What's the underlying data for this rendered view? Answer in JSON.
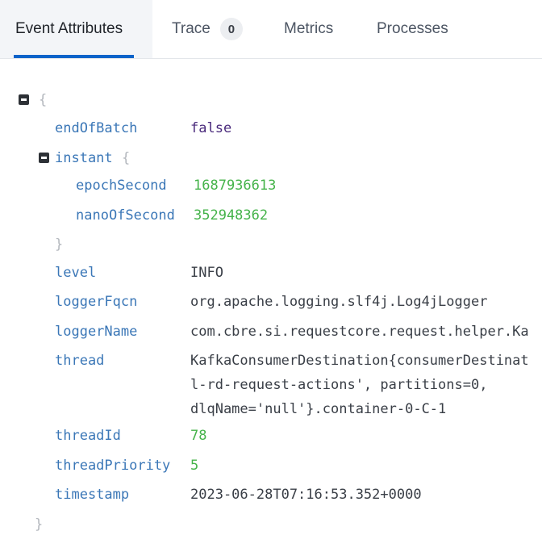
{
  "tabs": [
    {
      "label": "Event Attributes",
      "active": true
    },
    {
      "label": "Trace",
      "badge": "0"
    },
    {
      "label": "Metrics"
    },
    {
      "label": "Processes"
    }
  ],
  "tree": {
    "open_brace": "{",
    "close_brace": "}",
    "fields": {
      "endOfBatch": {
        "key": "endOfBatch",
        "value": "false"
      },
      "instant": {
        "key": "instant",
        "open": "{",
        "close": "}",
        "epochSecond": {
          "key": "epochSecond",
          "value": "1687936613"
        },
        "nanoOfSecond": {
          "key": "nanoOfSecond",
          "value": "352948362"
        }
      },
      "level": {
        "key": "level",
        "value": "INFO"
      },
      "loggerFqcn": {
        "key": "loggerFqcn",
        "value": "org.apache.logging.slf4j.Log4jLogger"
      },
      "loggerName": {
        "key": "loggerName",
        "value": "com.cbre.si.requestcore.request.helper.Ka"
      },
      "thread": {
        "key": "thread",
        "lines": [
          "KafkaConsumerDestination{consumerDestinat",
          "l-rd-request-actions', partitions=0,",
          "dlqName='null'}.container-0-C-1"
        ]
      },
      "threadId": {
        "key": "threadId",
        "value": "78"
      },
      "threadPriority": {
        "key": "threadPriority",
        "value": "5"
      },
      "timestamp": {
        "key": "timestamp",
        "value": "2023-06-28T07:16:53.352+0000"
      }
    }
  },
  "colors": {
    "key": "#3b77b7",
    "string": "#3a3f47",
    "number": "#45b34a",
    "boolean": "#4a2a7c",
    "brace": "#b3b7bd",
    "tab_active_underline": "#0a63c9"
  },
  "icons": {
    "collapse": "minus-square-icon"
  }
}
